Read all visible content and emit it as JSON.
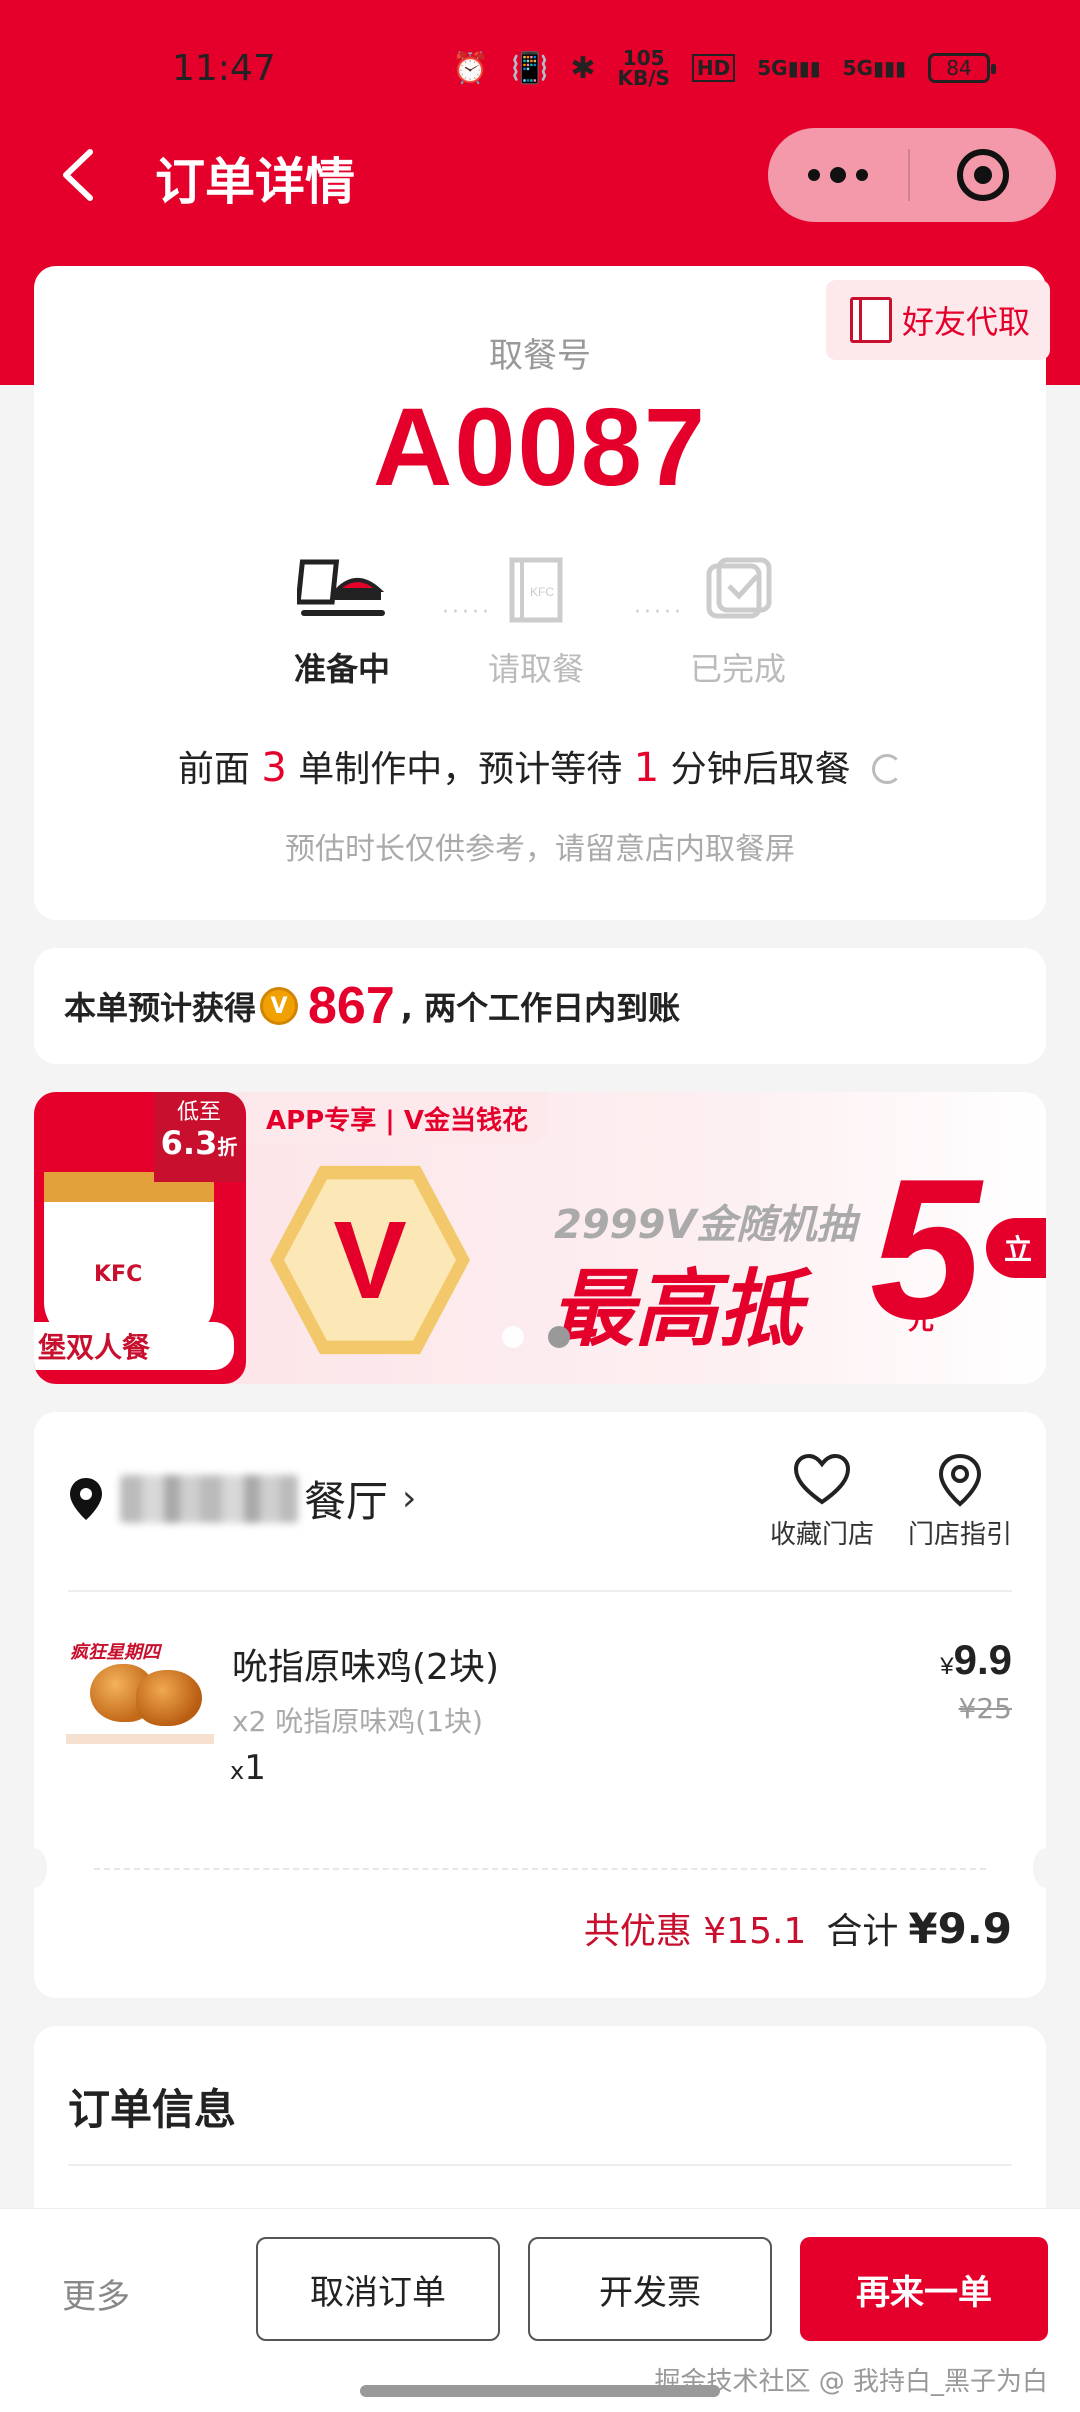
{
  "status_bar": {
    "time": "11:47",
    "net_speed_top": "105",
    "net_speed_unit": "KB/S",
    "hd": "HD",
    "signal1": "5G",
    "signal2": "5G",
    "battery": "84"
  },
  "nav": {
    "title": "订单详情"
  },
  "pickup": {
    "friend_button": "好友代取",
    "label": "取餐号",
    "number": "A0087",
    "steps": [
      {
        "label": "准备中",
        "state": "active"
      },
      {
        "label": "请取餐",
        "state": "inactive"
      },
      {
        "label": "已完成",
        "state": "inactive"
      }
    ],
    "wait": {
      "prefix": "前面",
      "orders_ahead": "3",
      "middle": "单制作中，预计等待",
      "minutes": "1",
      "suffix": "分钟后取餐"
    },
    "note": "预估时长仅供参考，请留意店内取餐屏"
  },
  "points": {
    "prefix": "本单预计获得",
    "coin": "V",
    "amount": "867",
    "suffix": ", 两个工作日内到账"
  },
  "banner": {
    "discount_top": "低至",
    "discount_value": "6.3",
    "discount_unit": "折",
    "combo_label": "堡双人餐",
    "app_tag": "APP专享 | V金当钱花",
    "hex_letter": "V",
    "subtitle": "2999V金随机抽",
    "main": "最高抵",
    "big_number": "5",
    "unit": "元",
    "go": "立",
    "active_dot": 1
  },
  "order": {
    "store_suffix": "餐厅",
    "actions": {
      "favorite": "收藏门店",
      "guide": "门店指引"
    },
    "product": {
      "promo_text": "疯狂星期四",
      "name": "吮指原味鸡(2块)",
      "sub": "x2 吮指原味鸡(1块)",
      "qty_prefix": "x",
      "qty": "1",
      "currency": "¥",
      "price": "9.9",
      "original_price": "¥25"
    },
    "savings": "共优惠 ¥15.1",
    "total_label": "合计",
    "total_value": "¥9.9"
  },
  "info": {
    "title": "订单信息"
  },
  "bottom": {
    "more": "更多",
    "cancel": "取消订单",
    "invoice": "开发票",
    "reorder": "再来一单",
    "watermark": "掘金技术社区 @ 我持白_黑子为白"
  },
  "colors": {
    "brand_red": "#e4002b",
    "coin": "#f0a000"
  }
}
